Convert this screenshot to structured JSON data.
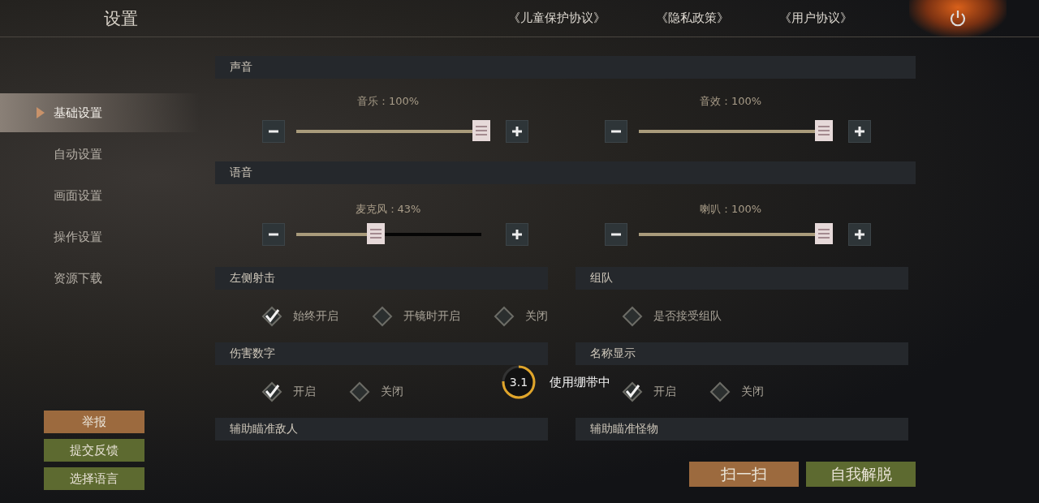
{
  "header": {
    "title": "设置",
    "links": [
      "《儿童保护协议》",
      "《隐私政策》",
      "《用户协议》"
    ]
  },
  "sidebar": {
    "items": [
      {
        "label": "基础设置",
        "selected": true
      },
      {
        "label": "自动设置",
        "selected": false
      },
      {
        "label": "画面设置",
        "selected": false
      },
      {
        "label": "操作设置",
        "selected": false
      },
      {
        "label": "资源下载",
        "selected": false
      }
    ],
    "buttons": [
      {
        "label": "举报",
        "color": "#9c6a3e"
      },
      {
        "label": "提交反馈",
        "color": "#5d6a30"
      },
      {
        "label": "选择语言",
        "color": "#5d6a30"
      }
    ]
  },
  "volume_sections": [
    {
      "title": "声音",
      "sliders": [
        {
          "label": "音乐：100%",
          "level": 1.0
        },
        {
          "label": "音效：100%",
          "level": 1.0
        }
      ]
    },
    {
      "title": "语音",
      "sliders": [
        {
          "label": "麦克风：43%",
          "level": 0.43
        },
        {
          "label": "喇叭：100%",
          "level": 1.0
        }
      ]
    }
  ],
  "option_rows": [
    [
      {
        "title": "左侧射击",
        "options": [
          {
            "label": "始终开启",
            "checked": true
          },
          {
            "label": "开镜时开启",
            "checked": false
          },
          {
            "label": "关闭",
            "checked": false
          }
        ]
      },
      {
        "title": "组队",
        "options": [
          {
            "label": "是否接受组队",
            "checked": false
          }
        ]
      }
    ],
    [
      {
        "title": "伤害数字",
        "options": [
          {
            "label": "开启",
            "checked": true
          },
          {
            "label": "关闭",
            "checked": false
          }
        ]
      },
      {
        "title": "名称显示",
        "options": [
          {
            "label": "开启",
            "checked": true
          },
          {
            "label": "关闭",
            "checked": false
          }
        ]
      }
    ],
    [
      {
        "title": "辅助瞄准敌人"
      },
      {
        "title": "辅助瞄准怪物"
      }
    ]
  ],
  "bottom_buttons": [
    {
      "label": "扫一扫",
      "color": "#9c6a3e"
    },
    {
      "label": "自我解脱",
      "color": "#5d6a30"
    }
  ],
  "toast": {
    "countdown": "3.1",
    "text": "使用绷带中"
  }
}
